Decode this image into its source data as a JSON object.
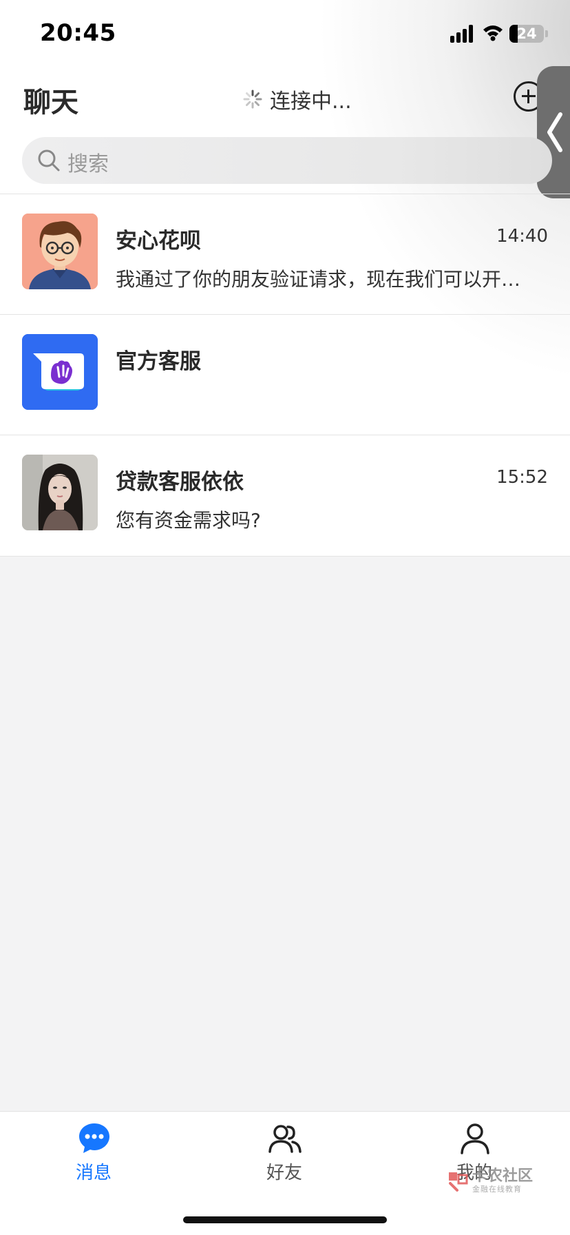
{
  "status_bar": {
    "time": "20:45",
    "battery": "24"
  },
  "header": {
    "title": "聊天",
    "connection_status": "连接中..."
  },
  "search": {
    "placeholder": "搜索"
  },
  "chats": [
    {
      "name": "安心花呗",
      "time": "14:40",
      "preview": "我通过了你的朋友验证请求，现在我们可以开始聊天了"
    },
    {
      "name": "官方客服",
      "time": "",
      "preview": ""
    },
    {
      "name": "贷款客服依依",
      "time": "15:52",
      "preview": "您有资金需求吗?"
    }
  ],
  "tabbar": {
    "tabs": [
      {
        "label": "消息",
        "active": true
      },
      {
        "label": "好友",
        "active": false
      },
      {
        "label": "我的",
        "active": false
      }
    ],
    "active_color": "#1677ff",
    "inactive_color": "#555555"
  },
  "watermark": {
    "title": "卡农社区",
    "subtitle": "金融在线教育"
  }
}
